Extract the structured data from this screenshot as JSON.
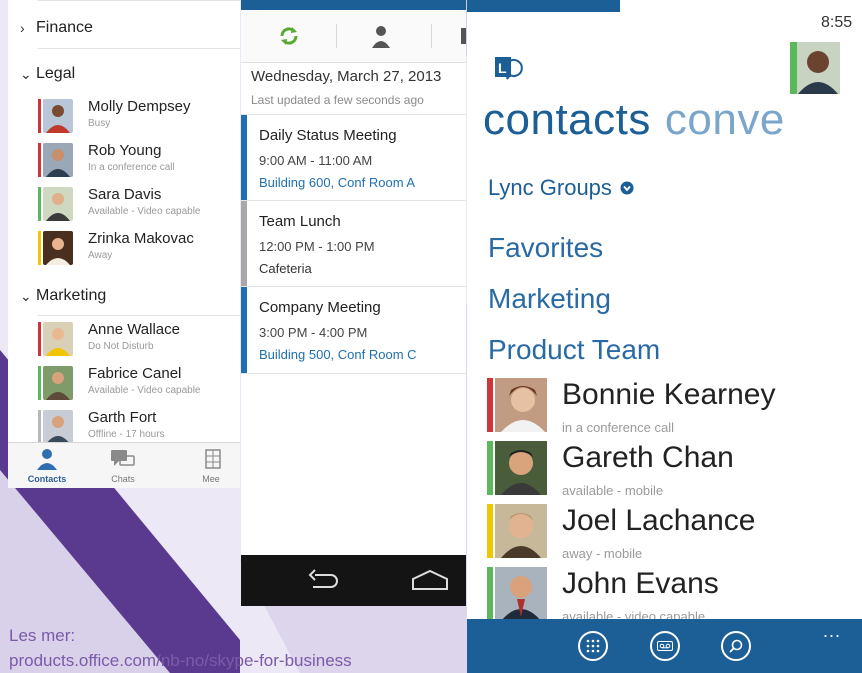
{
  "colors": {
    "accent": "#1c5e96",
    "busy": "#d13438",
    "available": "#5cb85c",
    "away": "#f2c500",
    "location": "#1f6fb2",
    "footer": "#7b5aa8"
  },
  "iphone": {
    "groups": [
      {
        "label": "Finance",
        "expanded": false
      },
      {
        "label": "Legal",
        "expanded": true
      },
      {
        "label": "Marketing",
        "expanded": true
      }
    ],
    "contacts": [
      {
        "name": "Molly Dempsey",
        "status": "Busy",
        "presence": "busy"
      },
      {
        "name": "Rob Young",
        "status": "In a conference call",
        "presence": "busy"
      },
      {
        "name": "Sara Davis",
        "status": "Available - Video capable",
        "presence": "available"
      },
      {
        "name": "Zrinka Makovac",
        "status": "Away",
        "presence": "away"
      },
      {
        "name": "Anne Wallace",
        "status": "Do Not Disturb",
        "presence": "busy"
      },
      {
        "name": "Fabrice Canel",
        "status": "Available - Video capable",
        "presence": "available"
      },
      {
        "name": "Garth Fort",
        "status": "Offline - 17 hours",
        "presence": "offline"
      }
    ],
    "tabs": [
      {
        "label": "Contacts",
        "icon": "person-icon",
        "active": true
      },
      {
        "label": "Chats",
        "icon": "chat-icon",
        "active": false
      },
      {
        "label": "Mee",
        "icon": "calendar-icon",
        "active": false
      }
    ]
  },
  "android": {
    "tabs": [
      "sync-icon",
      "person-icon",
      "calendar-icon"
    ],
    "date": "Wednesday, March 27, 2013",
    "updated": "Last updated a few seconds ago",
    "meetings": [
      {
        "title": "Daily Status Meeting",
        "time": "9:00 AM - 11:00 AM",
        "location": "Building 600, Conf Room A",
        "is_link": true
      },
      {
        "title": "Team Lunch",
        "time": "12:00 PM - 1:00 PM",
        "location": "Cafeteria",
        "is_link": false
      },
      {
        "title": "Company Meeting",
        "time": "3:00 PM - 4:00 PM",
        "location": "Building 500, Conf Room C",
        "is_link": true
      }
    ],
    "nav": [
      "back-icon",
      "home-icon"
    ]
  },
  "wp": {
    "clock": "8:55",
    "pivot_current": "contacts",
    "pivot_next": "conve",
    "groups_label": "Lync Groups",
    "groups": [
      "Favorites",
      "Marketing",
      "Product Team"
    ],
    "contacts": [
      {
        "name": "Bonnie Kearney",
        "status": "in a conference call",
        "presence": "busy"
      },
      {
        "name": "Gareth Chan",
        "status": "available - mobile",
        "presence": "available"
      },
      {
        "name": "Joel Lachance",
        "status": "away - mobile",
        "presence": "away"
      },
      {
        "name": "John Evans",
        "status": "available - video capable",
        "presence": "available"
      }
    ],
    "appbar": [
      "dialpad-icon",
      "voicemail-icon",
      "search-icon"
    ],
    "more": "..."
  },
  "footer": {
    "label": "Les mer:",
    "url": "products.office.com/nb-no/skype-for-business"
  }
}
